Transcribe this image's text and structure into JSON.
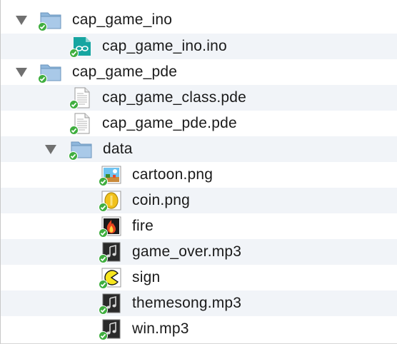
{
  "tree": {
    "items": [
      {
        "label": "cap_game_ino",
        "kind": "folder",
        "icon": "folder-icon",
        "expanded": true,
        "status": "synced"
      },
      {
        "label": "cap_game_ino.ino",
        "kind": "file",
        "icon": "arduino-file-icon",
        "status": "synced"
      },
      {
        "label": "cap_game_pde",
        "kind": "folder",
        "icon": "folder-icon",
        "expanded": true,
        "status": "synced"
      },
      {
        "label": "cap_game_class.pde",
        "kind": "file",
        "icon": "text-document-icon",
        "status": "synced"
      },
      {
        "label": "cap_game_pde.pde",
        "kind": "file",
        "icon": "text-document-icon",
        "status": "synced"
      },
      {
        "label": "data",
        "kind": "folder",
        "icon": "folder-icon",
        "expanded": true,
        "status": "synced"
      },
      {
        "label": "cartoon.png",
        "kind": "file",
        "icon": "image-thumbnail-icon",
        "status": "synced"
      },
      {
        "label": "coin.png",
        "kind": "file",
        "icon": "coin-thumbnail-icon",
        "status": "synced"
      },
      {
        "label": "fire",
        "kind": "file",
        "icon": "fire-icon",
        "status": "synced"
      },
      {
        "label": "game_over.mp3",
        "kind": "file",
        "icon": "music-note-icon",
        "status": "synced"
      },
      {
        "label": "sign",
        "kind": "file",
        "icon": "pacman-icon",
        "status": "synced"
      },
      {
        "label": "themesong.mp3",
        "kind": "file",
        "icon": "music-note-icon",
        "status": "synced"
      },
      {
        "label": "win.mp3",
        "kind": "file",
        "icon": "music-note-icon",
        "status": "synced"
      }
    ]
  },
  "colors": {
    "row_alt_bg": "#f1f4f8",
    "folder_blue": "#8fb7dc",
    "sync_green": "#3fae3f",
    "disclosure_gray": "#707070"
  }
}
